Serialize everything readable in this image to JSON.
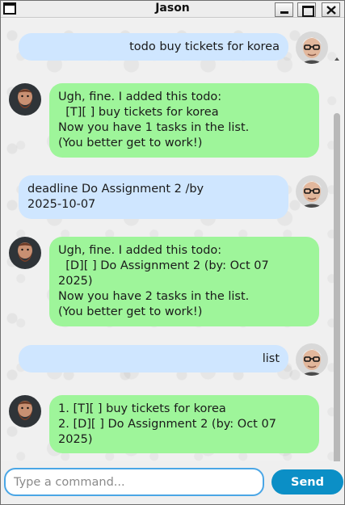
{
  "window": {
    "title": "Jason"
  },
  "messages": [
    {
      "sender": "user",
      "text": "todo buy tickets for korea"
    },
    {
      "sender": "bot",
      "text": "Ugh, fine. I added this todo:\n  [T][ ] buy tickets for korea\nNow you have 1 tasks in the list.\n(You better get to work!)"
    },
    {
      "sender": "user",
      "text": "deadline Do Assignment 2 /by\n2025-10-07"
    },
    {
      "sender": "bot",
      "text": "Ugh, fine. I added this todo:\n  [D][ ] Do Assignment 2 (by: Oct 07\n2025)\nNow you have 2 tasks in the list.\n(You better get to work!)"
    },
    {
      "sender": "user",
      "text": "list"
    },
    {
      "sender": "bot",
      "text": "1. [T][ ] buy tickets for korea\n2. [D][ ] Do Assignment 2 (by: Oct 07\n2025)"
    }
  ],
  "input": {
    "placeholder": "Type a command...",
    "value": ""
  },
  "send_button": {
    "label": "Send"
  },
  "colors": {
    "user_bubble": "#cfe6ff",
    "bot_bubble": "#9ef59a",
    "send_button": "#0b8fc6",
    "input_border": "#4aa6e6"
  }
}
